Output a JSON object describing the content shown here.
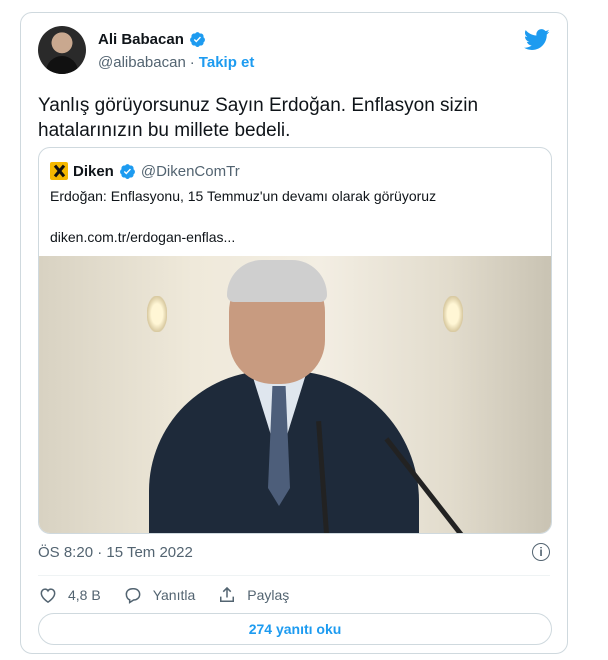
{
  "author": {
    "name": "Ali Babacan",
    "handle": "@alibabacan",
    "separator": "·",
    "follow_label": "Takip et"
  },
  "tweet": {
    "text_line1": "Yanlış görüyorsunuz Sayın Erdoğan. Enflasyon sizin",
    "text_line2": "hatalarınızın bu millete bedeli.",
    "timestamp": "ÖS 8:20 · 15 Tem 2022"
  },
  "quote": {
    "name": "Diken",
    "handle": "@DikenComTr",
    "text": "Erdoğan: Enflasyonu, 15 Temmuz'un devamı olarak görüyoruz",
    "link": "diken.com.tr/erdogan-enflas..."
  },
  "actions": {
    "likes": "4,8 B",
    "reply_label": "Yanıtla",
    "share_label": "Paylaş"
  },
  "replies_button": "274 yanıtı oku",
  "icons": {
    "brand": "twitter-bird-icon",
    "verified": "verified-badge-icon",
    "info": "info-icon",
    "like": "heart-icon",
    "reply": "reply-bubble-icon",
    "share": "share-icon"
  },
  "colors": {
    "accent": "#1d9bf0",
    "text": "#0f1419",
    "muted": "#536471",
    "border": "#cfd9de"
  }
}
